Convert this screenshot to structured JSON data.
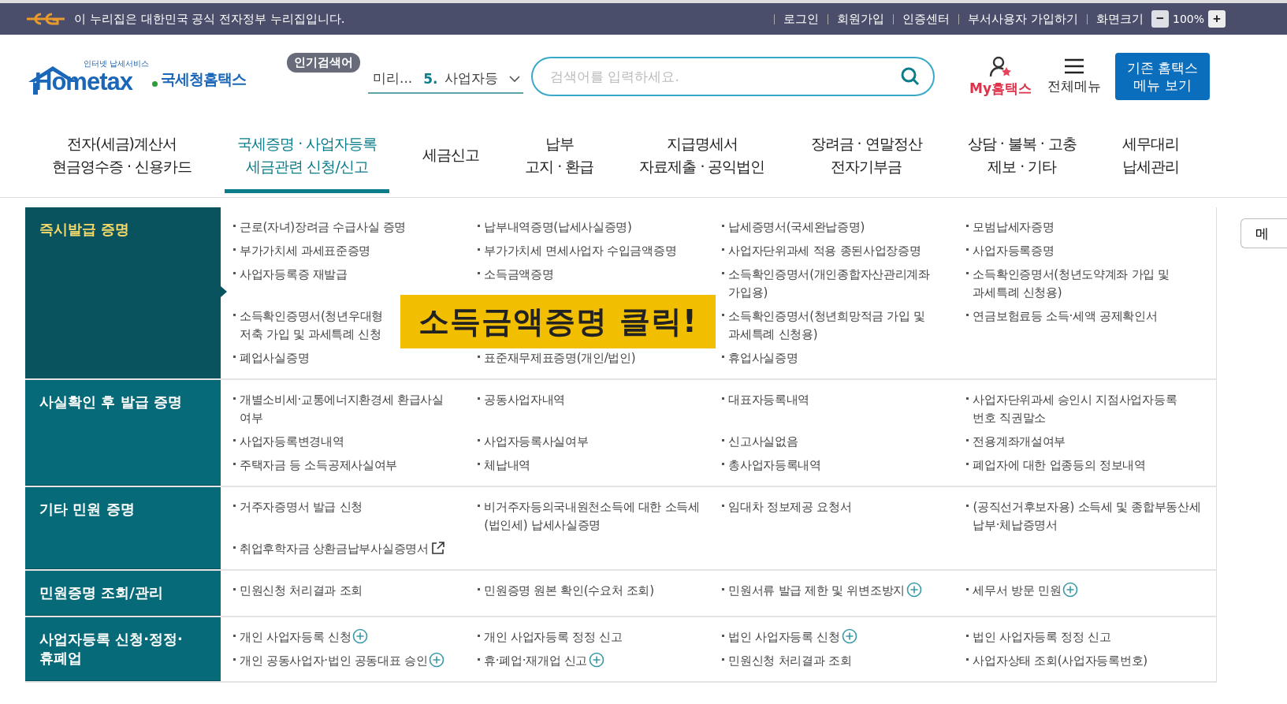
{
  "gov_bar": {
    "notice": "이 누리집은 대한민국 공식 전자정부 누리집입니다.",
    "links": [
      "로그인",
      "회원가입",
      "인증센터",
      "부서사용자 가입하기"
    ],
    "zoom_label": "화면크기",
    "zoom_out": "−",
    "zoom_value": "100%",
    "zoom_in": "+"
  },
  "header": {
    "logo_tagline": "인터넷 납세서비스",
    "logo_word": "Hometax",
    "logo_name": "국세청홈택스",
    "popular_badge": "인기검색어",
    "ticker_prev": "미리...",
    "ticker_rank": "5.",
    "ticker_term": "사업자등",
    "search": {
      "placeholder": "검색어를 입력하세요."
    },
    "my_label": "My홈택스",
    "all_menu": "전체메뉴",
    "classic_button": "기존 홈택스\n메뉴 보기"
  },
  "nav": [
    {
      "label": "전자(세금)계산서\n현금영수증 · 신용카드",
      "selected": false
    },
    {
      "label": "국세증명 · 사업자등록\n세금관련 신청/신고",
      "selected": true
    },
    {
      "label": "세금신고",
      "selected": false
    },
    {
      "label": "납부\n고지 · 환급",
      "selected": false
    },
    {
      "label": "지급명세서\n자료제출 · 공익법인",
      "selected": false
    },
    {
      "label": "장려금 · 연말정산\n전자기부금",
      "selected": false
    },
    {
      "label": "상담 · 불복 · 고충\n제보 · 기타",
      "selected": false
    },
    {
      "label": "세무대리\n납세관리",
      "selected": false
    }
  ],
  "side_button": "메",
  "sections": [
    {
      "title": "즉시발급 증명",
      "selected": true,
      "items": [
        {
          "kind": "plain",
          "text": "근로(자녀)장려금 수급사실 증명"
        },
        {
          "kind": "plain",
          "text": "납부내역증명(납세사실증명)"
        },
        {
          "kind": "plain",
          "text": "납세증명서(국세완납증명)"
        },
        {
          "kind": "plain",
          "text": "모범납세자증명"
        },
        {
          "kind": "plain",
          "text": "부가가치세 과세표준증명"
        },
        {
          "kind": "plain",
          "text": "부가가치세 면세사업자 수입금액증명"
        },
        {
          "kind": "plain",
          "text": "사업자단위과세 적용 종된사업장증명"
        },
        {
          "kind": "plain",
          "text": "사업자등록증명"
        },
        {
          "kind": "plain",
          "text": "사업자등록증 재발급"
        },
        {
          "kind": "plain",
          "text": "소득금액증명"
        },
        {
          "kind": "plain",
          "text": "소득확인증명서(개인종합자산관리계좌 가입용)"
        },
        {
          "kind": "plain",
          "text": "소득확인증명서(청년도약계좌 가입 및 과세특례 신청용)"
        },
        {
          "kind": "plain",
          "text": "소득확인증명서(청년우대형\n저축 가입 및 과세특례 신청"
        },
        {
          "kind": "callout",
          "text": "소득금액증명 클릭!"
        },
        {
          "kind": "plain",
          "text": "소득확인증명서(청년희망적금 가입 및 과세특례 신청용)"
        },
        {
          "kind": "plain",
          "text": "연금보험료등 소득·세액 공제확인서"
        },
        {
          "kind": "plain",
          "text": "폐업사실증명"
        },
        {
          "kind": "plain",
          "text": "표준재무제표증명(개인/법인)"
        },
        {
          "kind": "plain",
          "text": "휴업사실증명"
        }
      ]
    },
    {
      "title": "사실확인 후 발급 증명",
      "selected": false,
      "items": [
        {
          "kind": "plain",
          "text": "개별소비세·교통에너지환경세 환급사실 여부"
        },
        {
          "kind": "plain",
          "text": "공동사업자내역"
        },
        {
          "kind": "plain",
          "text": "대표자등록내역"
        },
        {
          "kind": "plain",
          "text": "사업자단위과세 승인시 지점사업자등록 번호 직권말소"
        },
        {
          "kind": "plain",
          "text": "사업자등록변경내역"
        },
        {
          "kind": "plain",
          "text": "사업자등록사실여부"
        },
        {
          "kind": "plain",
          "text": "신고사실없음"
        },
        {
          "kind": "plain",
          "text": "전용계좌개설여부"
        },
        {
          "kind": "plain",
          "text": "주택자금 등 소득공제사실여부"
        },
        {
          "kind": "plain",
          "text": "체납내역"
        },
        {
          "kind": "plain",
          "text": "총사업자등록내역"
        },
        {
          "kind": "plain",
          "text": "폐업자에 대한 업종등의 정보내역"
        }
      ]
    },
    {
      "title": "기타 민원 증명",
      "selected": false,
      "items": [
        {
          "kind": "plain",
          "text": "거주자증명서 발급 신청"
        },
        {
          "kind": "plain",
          "text": "비거주자등의국내원천소득에 대한 소득세(법인세) 납세사실증명"
        },
        {
          "kind": "plain",
          "text": "임대차 정보제공 요청서"
        },
        {
          "kind": "plain",
          "text": "(공직선거후보자용) 소득세 및 종합부동산세 납부·체납증명서"
        },
        {
          "kind": "external",
          "text": "취업후학자금 상환금납부사실증명서"
        }
      ]
    },
    {
      "title": "민원증명 조회/관리",
      "selected": false,
      "items": [
        {
          "kind": "plain",
          "text": "민원신청 처리결과 조회"
        },
        {
          "kind": "plain",
          "text": "민원증명 원본 확인(수요처 조회)"
        },
        {
          "kind": "plus",
          "text": "민원서류 발급 제한 및 위변조방지"
        },
        {
          "kind": "plus",
          "text": "세무서 방문 민원"
        }
      ]
    },
    {
      "title": "사업자등록 신청·정정·\n휴폐업",
      "selected": false,
      "items": [
        {
          "kind": "plus",
          "text": "개인 사업자등록 신청"
        },
        {
          "kind": "plain",
          "text": "개인 사업자등록 정정 신고"
        },
        {
          "kind": "plus",
          "text": "법인 사업자등록 신청"
        },
        {
          "kind": "plain",
          "text": "법인 사업자등록 정정 신고"
        },
        {
          "kind": "plus",
          "text": "개인 공동사업자·법인 공동대표 승인"
        },
        {
          "kind": "plus",
          "text": "휴·폐업·재개업 신고"
        },
        {
          "kind": "plain",
          "text": "민원신청 처리결과 조회"
        },
        {
          "kind": "plain",
          "text": "사업자상태 조회(사업자등록번호)"
        }
      ]
    }
  ]
}
